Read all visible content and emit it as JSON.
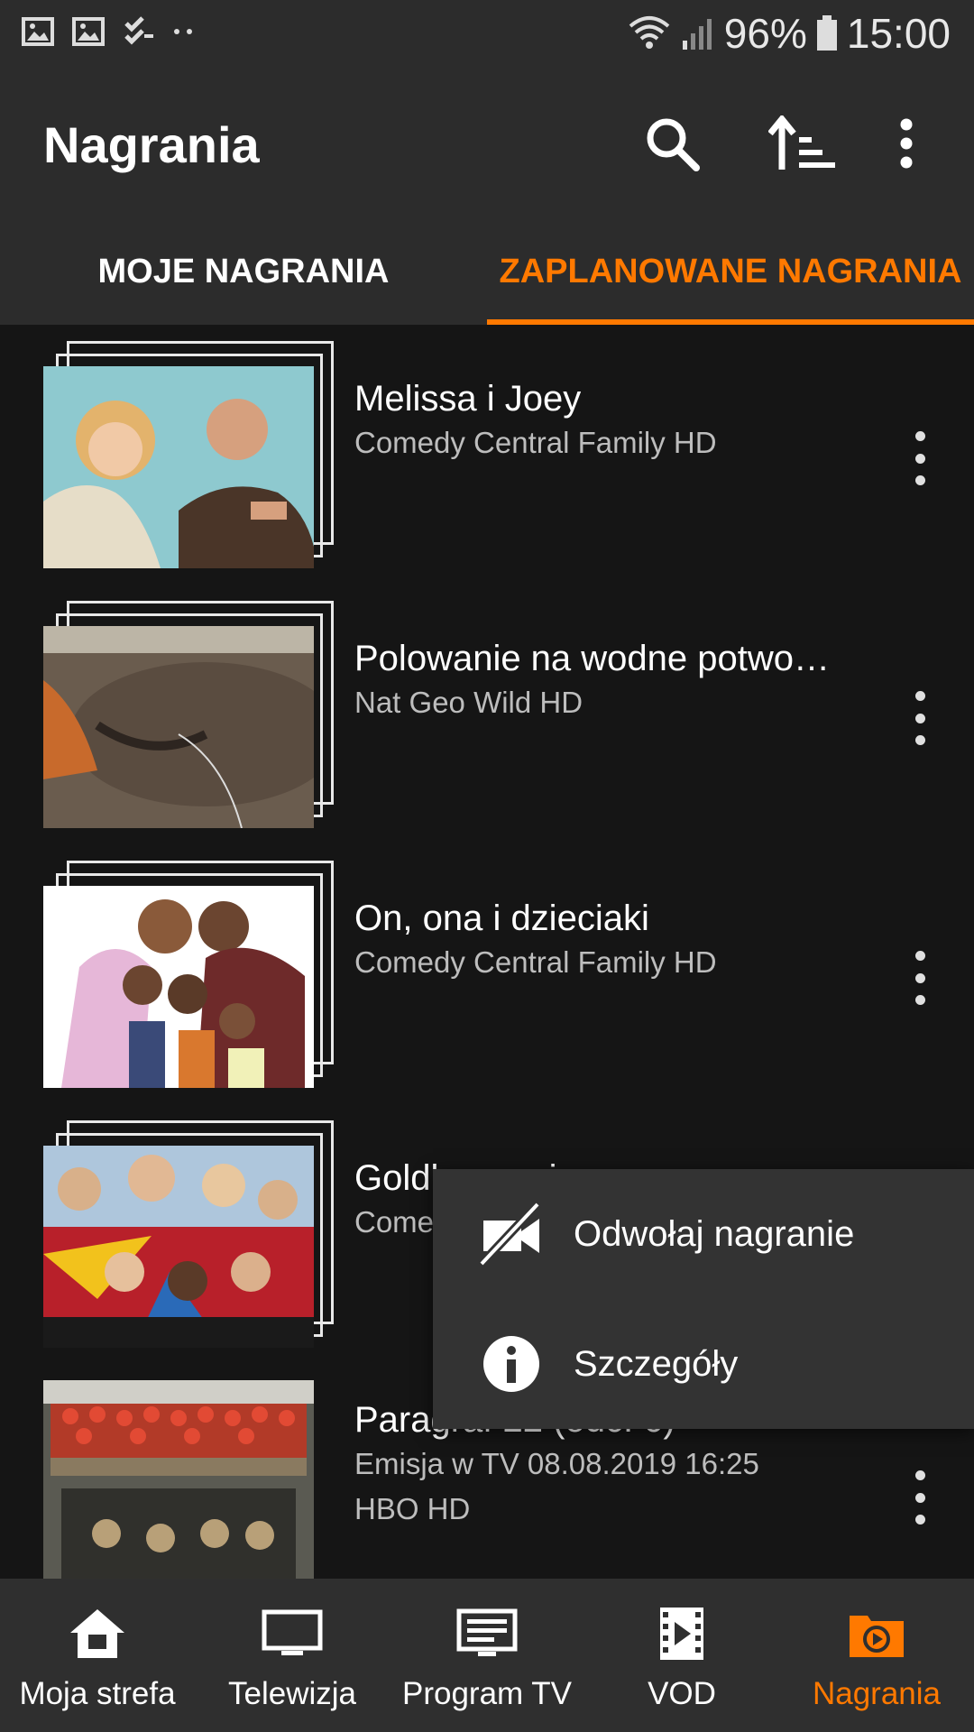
{
  "status_bar": {
    "battery": "96%",
    "time": "15:00"
  },
  "app_bar": {
    "title": "Nagrania"
  },
  "tabs": [
    {
      "label": "MOJE NAGRANIA",
      "active": false
    },
    {
      "label": "ZAPLANOWANE NAGRANIA",
      "active": true
    }
  ],
  "recordings": [
    {
      "title": "Melissa i Joey",
      "subtitle": "Comedy Central Family HD"
    },
    {
      "title": "Polowanie na wodne potwo…",
      "subtitle": "Nat Geo Wild HD"
    },
    {
      "title": "On, ona i dzieciaki",
      "subtitle": "Comedy Central Family HD"
    },
    {
      "title": "Goldbergowie",
      "subtitle": "Comedy Central Family HD"
    },
    {
      "title": "Paragraf 22 (odc. 6)",
      "subtitle": "Emisja w TV 08.08.2019 16:25",
      "subtitle2": "HBO HD"
    }
  ],
  "context_menu": {
    "items": [
      {
        "label": "Odwołaj nagranie",
        "icon": "camera-off-icon"
      },
      {
        "label": "Szczegóły",
        "icon": "info-icon"
      }
    ]
  },
  "bottom_nav": [
    {
      "label": "Moja strefa",
      "icon": "home-icon"
    },
    {
      "label": "Telewizja",
      "icon": "tv-icon"
    },
    {
      "label": "Program TV",
      "icon": "tv-guide-icon"
    },
    {
      "label": "VOD",
      "icon": "film-icon"
    },
    {
      "label": "Nagrania",
      "icon": "recordings-icon",
      "active": true
    }
  ],
  "colors": {
    "accent": "#ff7900",
    "bar": "#2c2c2c",
    "background": "#151515"
  }
}
